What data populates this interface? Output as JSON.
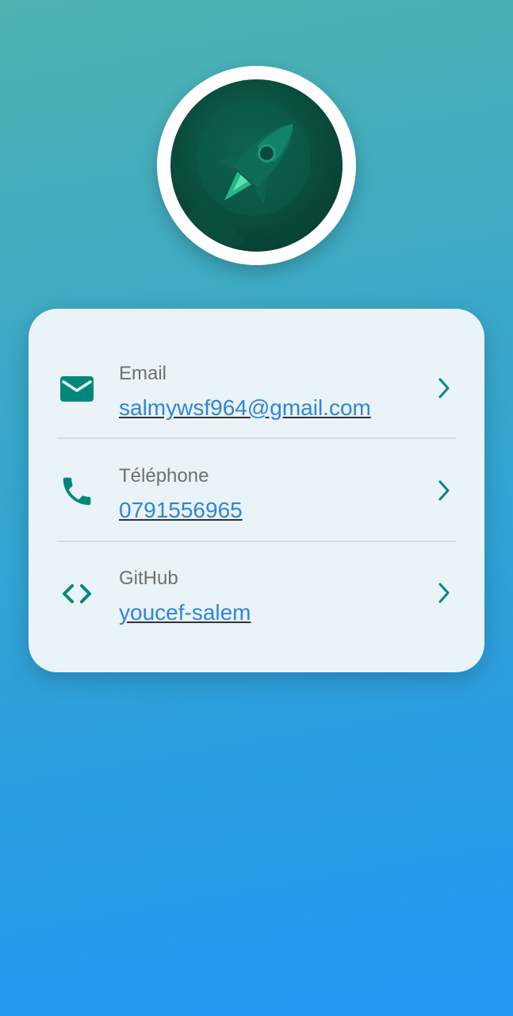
{
  "profile": {
    "avatar_icon": "rocket-icon"
  },
  "contacts": [
    {
      "label": "Email",
      "value": "salmywsf964@gmail.com",
      "icon": "mail-icon"
    },
    {
      "label": "Téléphone",
      "value": "0791556965",
      "icon": "phone-icon"
    },
    {
      "label": "GitHub",
      "value": "youcef-salem",
      "icon": "code-icon"
    }
  ],
  "colors": {
    "accent": "#00897b",
    "link": "#2f86d8",
    "card_bg": "#eaf3f8"
  }
}
